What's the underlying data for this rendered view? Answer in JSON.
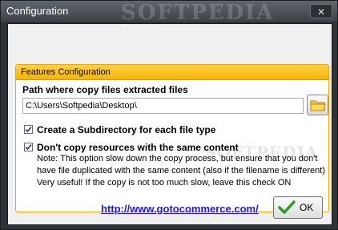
{
  "window": {
    "title": "Configuration",
    "watermark": "SOFTPEDIA",
    "close_label": "✕"
  },
  "features": {
    "title": "Features Configuration",
    "path_label": "Path where copy files extracted files",
    "path_value": "C:\\Users\\Softpedia\\Desktop\\",
    "option1": {
      "label": "Create a Subdirectory for each file type",
      "checked": true
    },
    "option2": {
      "label": "Don't copy resources with the same content",
      "checked": true
    },
    "note_lines": [
      "Note: This option slow down the copy process, but ensure that you don't",
      "have file duplicated with the same content (also if the filename is different)",
      "Very useful! If the copy is not too much slow, leave this check ON"
    ],
    "watermark": "SOFTPEDIA"
  },
  "footer": {
    "link": "http://www.gotocommerce.com/",
    "ok_label": "OK"
  },
  "colors": {
    "header_orange": "#f7b400",
    "link_blue": "#1a1ae0",
    "check_green": "#2f9a2f"
  },
  "icons": {
    "folder": "folder-icon",
    "check": "checkmark-icon",
    "close": "close-icon"
  }
}
